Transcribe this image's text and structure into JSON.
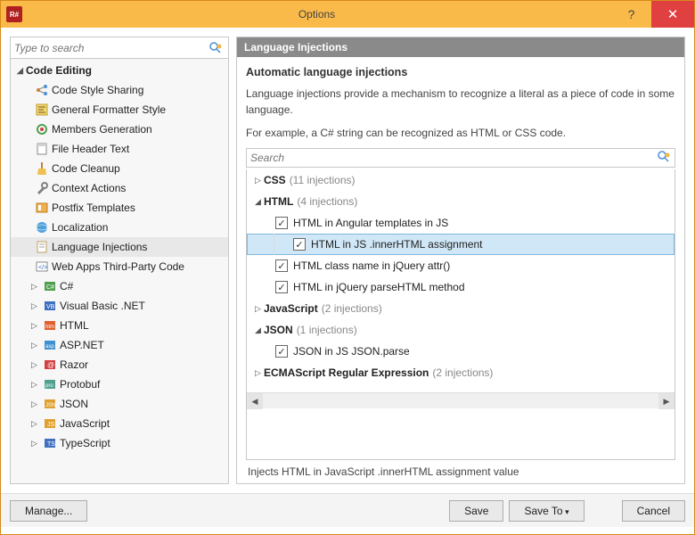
{
  "window": {
    "title": "Options"
  },
  "leftSearch": {
    "placeholder": "Type to search"
  },
  "tree": {
    "root": {
      "label": "Code Editing"
    },
    "items": [
      {
        "label": "Code Style Sharing"
      },
      {
        "label": "General Formatter Style"
      },
      {
        "label": "Members Generation"
      },
      {
        "label": "File Header Text"
      },
      {
        "label": "Code Cleanup"
      },
      {
        "label": "Context Actions"
      },
      {
        "label": "Postfix Templates"
      },
      {
        "label": "Localization"
      },
      {
        "label": "Language Injections"
      },
      {
        "label": "Web Apps Third-Party Code"
      },
      {
        "label": "C#"
      },
      {
        "label": "Visual Basic .NET"
      },
      {
        "label": "HTML"
      },
      {
        "label": "ASP.NET"
      },
      {
        "label": "Razor"
      },
      {
        "label": "Protobuf"
      },
      {
        "label": "JSON"
      },
      {
        "label": "JavaScript"
      },
      {
        "label": "TypeScript"
      }
    ]
  },
  "panel": {
    "header": "Language Injections",
    "title": "Automatic language injections",
    "desc1": "Language injections provide a mechanism to recognize a literal as a piece of code in some language.",
    "desc2": "For example, a C# string can be recognized as HTML or CSS code.",
    "searchPlaceholder": "Search",
    "status": "Injects HTML in JavaScript .innerHTML assignment value"
  },
  "injections": {
    "css": {
      "label": "CSS",
      "count": "(11 injections)"
    },
    "html": {
      "label": "HTML",
      "count": "(4 injections)",
      "children": [
        {
          "label": "HTML in Angular templates in JS"
        },
        {
          "label": "HTML in JS .innerHTML assignment"
        },
        {
          "label": "HTML class name in jQuery attr()"
        },
        {
          "label": "HTML in jQuery parseHTML method"
        }
      ]
    },
    "js": {
      "label": "JavaScript",
      "count": "(2 injections)"
    },
    "json": {
      "label": "JSON",
      "count": "(1 injections)",
      "children": [
        {
          "label": "JSON in JS JSON.parse"
        }
      ]
    },
    "regex": {
      "label": "ECMAScript Regular Expression",
      "count": "(2 injections)"
    }
  },
  "buttons": {
    "manage": "Manage...",
    "save": "Save",
    "saveTo": "Save To",
    "cancel": "Cancel"
  }
}
